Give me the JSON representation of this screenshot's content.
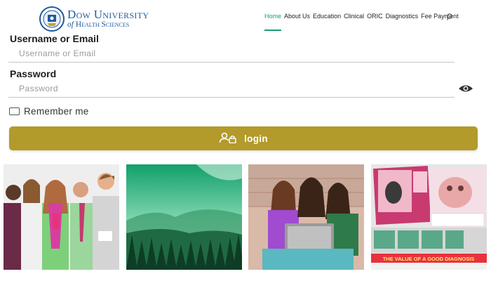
{
  "header": {
    "logo": {
      "line1": "Dow University",
      "line2_of": "of",
      "line2_rest": "Health Sciences"
    },
    "nav": [
      {
        "label": "Home",
        "active": true
      },
      {
        "label": "About Us"
      },
      {
        "label": "Education"
      },
      {
        "label": "Clinical"
      },
      {
        "label": "ORIC"
      },
      {
        "label": "Diagnostics"
      },
      {
        "label": "Fee Payment"
      }
    ],
    "search_icon": "search-icon"
  },
  "form": {
    "username": {
      "label": "Username or Email",
      "placeholder": "Username or Email",
      "value": ""
    },
    "password": {
      "label": "Password",
      "placeholder": "Password",
      "value": ""
    },
    "remember_label": "Remember me",
    "remember_checked": false,
    "login_label": "login",
    "login_icon": "user-lock-icon",
    "eye_icon": "eye-icon"
  },
  "gallery": {
    "tile4_banner": "THE VALUE OF A GOOD DIAGNOSIS"
  },
  "colors": {
    "accent_green": "#1a9e6a",
    "login_gold": "#b39a2a",
    "brand_blue": "#1f5a9e",
    "banner_red": "#e8323e"
  }
}
